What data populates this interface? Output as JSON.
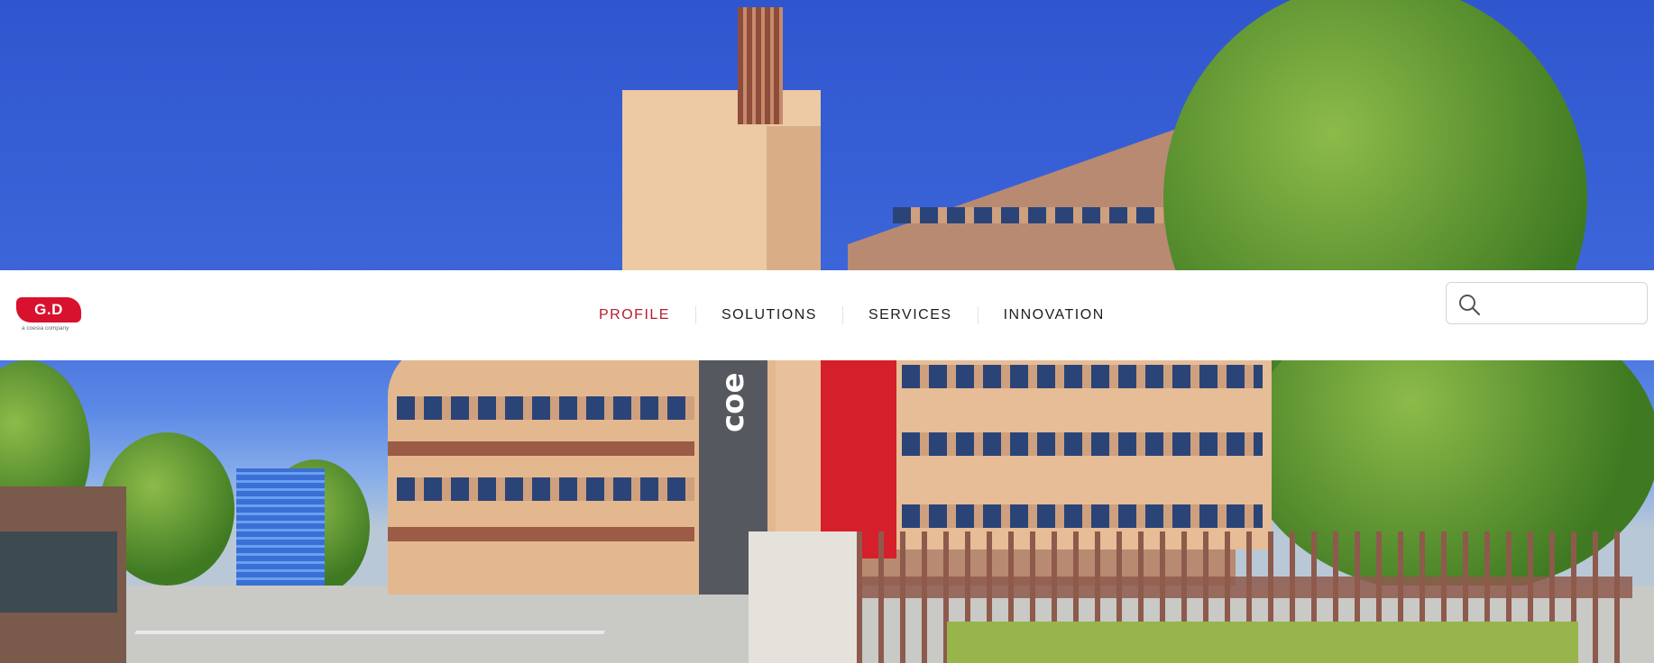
{
  "brand": {
    "logo_text": "G.D",
    "logo_tagline": "a coesia company",
    "accent_color": "#d8112e"
  },
  "nav": {
    "items": [
      {
        "label": "PROFILE",
        "active": true
      },
      {
        "label": "SOLUTIONS",
        "active": false
      },
      {
        "label": "SERVICES",
        "active": false
      },
      {
        "label": "INNOVATION",
        "active": false
      }
    ],
    "active_color": "#b51c2d"
  },
  "search": {
    "icon": "search-icon",
    "value": "",
    "placeholder": ""
  },
  "hero": {
    "totem_text": "coe"
  }
}
